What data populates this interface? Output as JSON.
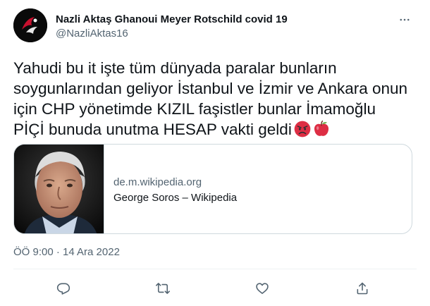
{
  "user": {
    "name": "Nazli Aktaş Ghanoui Meyer Rotschild covid 19",
    "handle": "@NazliAktas16"
  },
  "tweet": {
    "lines": [
      "Yahudi bu it işte tüm dünyada paralar bunların",
      "soygunlarından geliyor İstanbul ve İzmir ve Ankara onun",
      "için CHP yönetimde KIZIL faşistler bunlar İmamoğlu",
      "PİÇİ bunuda unutma HESAP vakti geldi"
    ],
    "emojis": [
      "angry-face-emoji",
      "red-apple-emoji"
    ],
    "timestamp": "ÖÖ 9:00 · 14 Ara 2022"
  },
  "link_card": {
    "domain": "de.m.wikipedia.org",
    "title": "George Soros – Wikipedia"
  },
  "actions": [
    "reply-icon",
    "retweet-icon",
    "like-icon",
    "share-icon"
  ],
  "colors": {
    "text": "#0f1419",
    "secondary": "#536471",
    "border": "#cfd9de",
    "emoji_red": "#e0245e"
  }
}
